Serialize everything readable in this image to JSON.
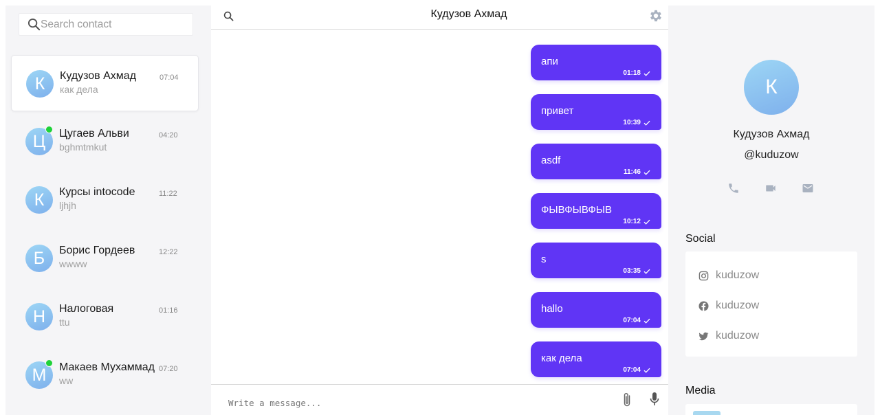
{
  "search": {
    "placeholder": "Search contact"
  },
  "contacts": [
    {
      "initial": "К",
      "name": "Кудузов Ахмад",
      "last": "как дела",
      "time": "07:04",
      "online": false,
      "active": true
    },
    {
      "initial": "Ц",
      "name": "Цугаев Альви",
      "last": "bghmtmkut",
      "time": "04:20",
      "online": true,
      "active": false
    },
    {
      "initial": "К",
      "name": "Курсы intocode",
      "last": "ljhjh",
      "time": "11:22",
      "online": false,
      "active": false
    },
    {
      "initial": "Б",
      "name": "Борис Гордеев",
      "last": "wwww",
      "time": "12:22",
      "online": false,
      "active": false
    },
    {
      "initial": "Н",
      "name": "Налоговая",
      "last": "ttu",
      "time": "01:16",
      "online": false,
      "active": false
    },
    {
      "initial": "М",
      "name": "Макаев Мухаммад",
      "last": "ww",
      "time": "07:20",
      "online": true,
      "active": false
    }
  ],
  "chat": {
    "title": "Кудузов Ахмад",
    "messages": [
      {
        "text": "апи",
        "time": "01:18"
      },
      {
        "text": "привет",
        "time": "10:39"
      },
      {
        "text": "asdf",
        "time": "11:46"
      },
      {
        "text": "ФЫВФЫВФЫВ",
        "time": "10:12"
      },
      {
        "text": "s",
        "time": "03:35"
      },
      {
        "text": "hallo",
        "time": "07:04"
      },
      {
        "text": "как дела",
        "time": "07:04"
      }
    ],
    "composer_placeholder": "Write a message..."
  },
  "profile": {
    "initial": "К",
    "name": "Кудузов Ахмад",
    "handle": "@kuduzow",
    "social_title": "Social",
    "social": [
      {
        "network": "instagram",
        "icon": "instagram-icon",
        "handle": "kuduzow"
      },
      {
        "network": "facebook",
        "icon": "facebook-icon",
        "handle": "kuduzow"
      },
      {
        "network": "twitter",
        "icon": "twitter-icon",
        "handle": "kuduzow"
      }
    ],
    "media_title": "Media"
  },
  "colors": {
    "accent": "#6035f5",
    "online": "#1fd239",
    "panel": "#f5f5f7",
    "icon_gray": "#a9b2c0"
  }
}
